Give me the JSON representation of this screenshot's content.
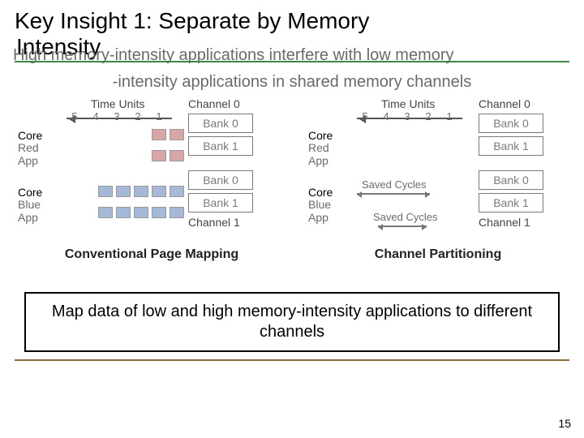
{
  "title": "Key Insight 1: Separate by Memory",
  "title_frag": "Intensity",
  "subtitle_line1": "High memory-intensity applications interfere with low memory",
  "subtitle_line2": "-intensity applications in shared memory channels",
  "diagram": {
    "time_units_label": "Time Units",
    "ticks": [
      "5",
      "4",
      "3",
      "2",
      "1"
    ],
    "channel0": "Channel 0",
    "channel1": "Channel 1",
    "bank0": "Bank 0",
    "bank1": "Bank 1",
    "core": "Core",
    "red_app": "Red App",
    "blue_app": "Blue App",
    "saved_cycles": "Saved Cycles",
    "caption_left": "Conventional Page Mapping",
    "caption_right": "Channel Partitioning"
  },
  "callout": "Map data of low and high memory-intensity applications to different channels",
  "page_number": "15"
}
